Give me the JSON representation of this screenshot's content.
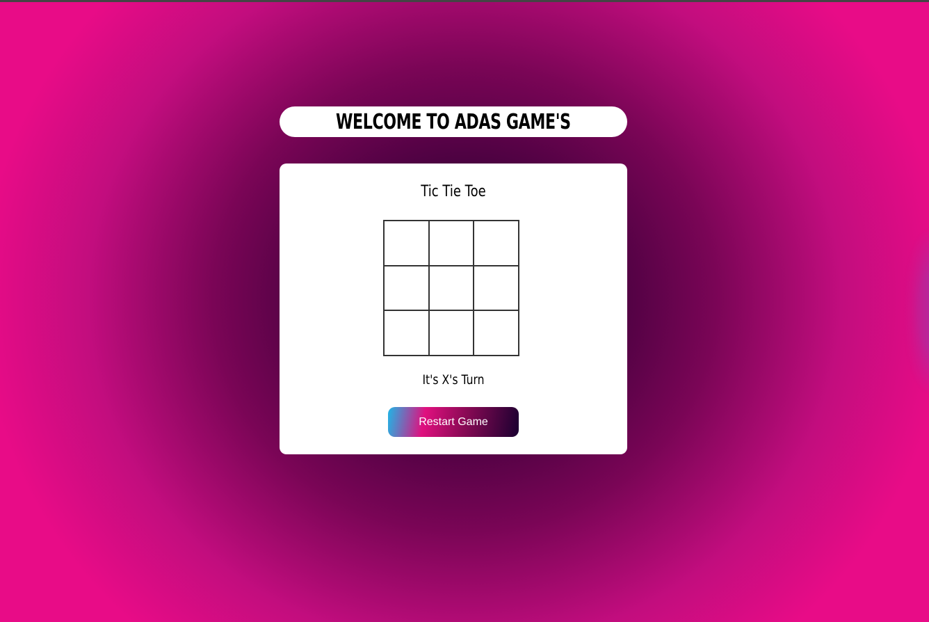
{
  "header": {
    "title": "WELCOME TO ADAS GAME'S"
  },
  "game": {
    "title": "Tic Tie Toe",
    "board": [
      "",
      "",
      "",
      "",
      "",
      "",
      "",
      "",
      ""
    ],
    "status": "It's X's Turn",
    "restart_label": "Restart Game"
  },
  "colors": {
    "background_center": "#1f0026",
    "background_edge": "#e80c87",
    "button_gradient": [
      "#1fb6e6",
      "#e0107f",
      "#8a0a55",
      "#1a0030"
    ]
  }
}
